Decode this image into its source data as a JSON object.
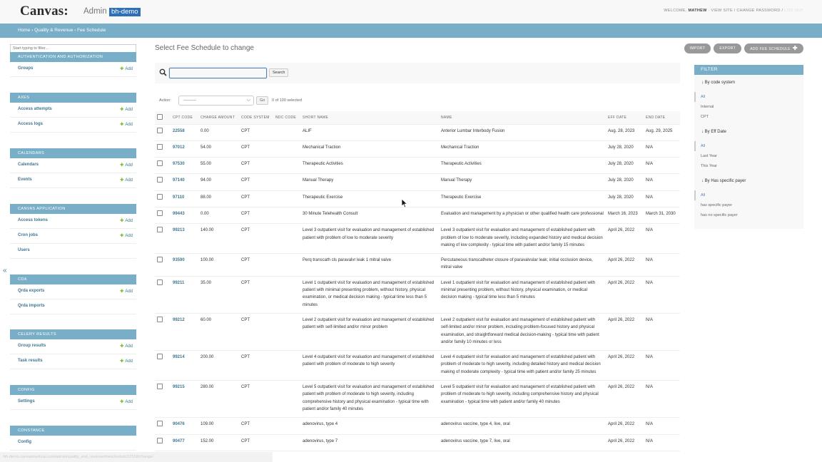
{
  "header": {
    "brand": "Canvas:",
    "admin": "Admin",
    "site": "bh-demo",
    "welcome": "WELCOME,",
    "user": "MATHEW",
    "view_site": "VIEW SITE",
    "change_password": "CHANGE PASSWORD",
    "logout": "LOG OUT"
  },
  "breadcrumbs": "Home › Quality & Revenue › Fee Schedule",
  "sidebar": {
    "filter_placeholder": "Start typing to filter...",
    "add_label": "Add",
    "collapse": "«",
    "modules": [
      {
        "caption": "AUTHENTICATION AND AUTHORIZATION",
        "rows": [
          {
            "name": "Groups",
            "add": true
          }
        ]
      },
      {
        "caption": "AXES",
        "rows": [
          {
            "name": "Access attempts",
            "add": true
          },
          {
            "name": "Access logs",
            "add": true
          }
        ]
      },
      {
        "caption": "CALENDARS",
        "rows": [
          {
            "name": "Calendars",
            "add": true
          },
          {
            "name": "Events",
            "add": true
          }
        ]
      },
      {
        "caption": "CANVAS APPLICATION",
        "rows": [
          {
            "name": "Access tokens",
            "add": true
          },
          {
            "name": "Cron jobs",
            "add": true
          },
          {
            "name": "Users",
            "add": false
          }
        ]
      },
      {
        "caption": "CDA",
        "rows": [
          {
            "name": "Qrda exports",
            "add": true
          },
          {
            "name": "Qrda imports",
            "add": false
          }
        ]
      },
      {
        "caption": "CELERY RESULTS",
        "rows": [
          {
            "name": "Group results",
            "add": true
          },
          {
            "name": "Task results",
            "add": true
          }
        ]
      },
      {
        "caption": "CONFIG",
        "rows": [
          {
            "name": "Settings",
            "add": true
          }
        ]
      },
      {
        "caption": "CONSTANCE",
        "rows": [
          {
            "name": "Config",
            "add": false
          }
        ]
      }
    ]
  },
  "content": {
    "title": "Select Fee Schedule to change",
    "tools": {
      "import": "IMPORT",
      "export": "EXPORT",
      "add": "ADD FEE SCHEDULE",
      "add_icon": "plus-icon"
    },
    "search": {
      "button": "Search",
      "value": "",
      "icon": "search-icon"
    },
    "actions": {
      "label": "Action:",
      "selected": "---------",
      "go": "Go",
      "counter": "0 of 100 selected"
    },
    "columns": [
      "CPT CODE",
      "CHARGE AMOUNT",
      "CODE SYSTEM",
      "NDC CODE",
      "SHORT NAME",
      "NAME",
      "EFF DATE",
      "END DATE"
    ],
    "rows": [
      {
        "cpt": "22558",
        "amount": "0.00",
        "system": "CPT",
        "ndc": "",
        "short": "ALIF",
        "name": "Anterior Lumbar Interbody Fusion",
        "eff": "Aug. 28, 2023",
        "end": "Aug. 29, 2025"
      },
      {
        "cpt": "97012",
        "amount": "54.00",
        "system": "CPT",
        "ndc": "",
        "short": "Mechanical Traction",
        "name": "Mechanical Traction",
        "eff": "July 28, 2020",
        "end": "N/A"
      },
      {
        "cpt": "97530",
        "amount": "55.00",
        "system": "CPT",
        "ndc": "",
        "short": "Therapeutic Activities",
        "name": "Therapeutic Activities",
        "eff": "July 28, 2020",
        "end": "N/A"
      },
      {
        "cpt": "97140",
        "amount": "94.00",
        "system": "CPT",
        "ndc": "",
        "short": "Manual Therapy",
        "name": "Manual Therapy",
        "eff": "July 28, 2020",
        "end": "N/A"
      },
      {
        "cpt": "97110",
        "amount": "88.00",
        "system": "CPT",
        "ndc": "",
        "short": "Therapeutic Exercise",
        "name": "Therapeutic Exercise",
        "eff": "July 28, 2020",
        "end": "N/A"
      },
      {
        "cpt": "99443",
        "amount": "0.00",
        "system": "CPT",
        "ndc": "",
        "short": "30 Minute Telehealth Consult",
        "name": "Evaluation and management by a physician or other qualified health care professional",
        "eff": "March 16, 2023",
        "end": "March 31, 2030"
      },
      {
        "cpt": "99213",
        "amount": "140.00",
        "system": "CPT",
        "ndc": "",
        "short": "Level 3 outpatient visit for evaluation and management of established patient with problem of low to moderate severity",
        "name": "Level 3 outpatient visit for evaluation and management of established patient with problem of low to moderate severity, including expanded history and medical decision making of low complexity - typical time with patient and/or family 15 minutes",
        "eff": "April 26, 2022",
        "end": "N/A"
      },
      {
        "cpt": "93590",
        "amount": "100.00",
        "system": "CPT",
        "ndc": "",
        "short": "Perq transcath cls paravalvr leak 1 mitral valve",
        "name": "Percutaneous transcatheter closure of paravalvular leak; initial occlusion device, mitral valve",
        "eff": "April 26, 2022",
        "end": "N/A"
      },
      {
        "cpt": "99211",
        "amount": "35.00",
        "system": "CPT",
        "ndc": "",
        "short": "Level 1 outpatient visit for evaluation and management of established patient with minimal presenting problem, without history, physical examination, or medical decision making - typical time less than 5 minutes",
        "name": "Level 1 outpatient visit for evaluation and management of established patient with minimal presenting problem, without history, physical examination, or medical decision making - typical time less than 5 minutes",
        "eff": "April 26, 2022",
        "end": "N/A"
      },
      {
        "cpt": "99212",
        "amount": "60.00",
        "system": "CPT",
        "ndc": "",
        "short": "Level 2 outpatient visit for evaluation and management of established patient with self-limited and/or minor problem",
        "name": "Level 2 outpatient visit for evaluation and management of established patient with self-limited and/or minor problem, including problem-focused history and physical examination, and straightforward medical decision-making - typical time with patient and/or family 10 minutes or less",
        "eff": "April 26, 2022",
        "end": "N/A"
      },
      {
        "cpt": "99214",
        "amount": "200.00",
        "system": "CPT",
        "ndc": "",
        "short": "Level 4 outpatient visit for evaluation and management of established patient with problem of moderate to high severity",
        "name": "Level 4 outpatient visit for evaluation and management of established patient with problem of moderate to high severity, including detailed history and medical decision making of moderate complexity - typical time with patient and/or family 25 minutes",
        "eff": "April 26, 2022",
        "end": "N/A"
      },
      {
        "cpt": "99215",
        "amount": "280.00",
        "system": "CPT",
        "ndc": "",
        "short": "Level 5 outpatient visit for evaluation and management of established patient with problem of moderate to high severity, including comprehensive history and physical examination - typical time with patient and/or family 40 minutes",
        "name": "Level 5 outpatient visit for evaluation and management of established patient with problem of moderate to high severity, including comprehensive history and physical examination - typical time with patient and/or family 40 minutes",
        "eff": "April 26, 2022",
        "end": "N/A"
      },
      {
        "cpt": "90476",
        "amount": "109.00",
        "system": "CPT",
        "ndc": "",
        "short": "adenovirus, type 4",
        "name": "adenovirus vaccine, type 4, live, oral",
        "eff": "April 26, 2022",
        "end": "N/A"
      },
      {
        "cpt": "90477",
        "amount": "152.00",
        "system": "CPT",
        "ndc": "",
        "short": "adenovirus, type 7",
        "name": "adenovirus vaccine, type 7, live, oral",
        "eff": "April 26, 2022",
        "end": "N/A"
      }
    ]
  },
  "filter": {
    "title": "FILTER",
    "groups": [
      {
        "heading": "↓ By code system",
        "options": [
          "All",
          "Internal",
          "CPT"
        ],
        "selected": 0
      },
      {
        "heading": "↓ By Eff Date",
        "options": [
          "All",
          "Last Year",
          "This Year"
        ],
        "selected": 0
      },
      {
        "heading": "↓ By Has specific payer",
        "options": [
          "All",
          "has specific payer",
          "has no specific payer"
        ],
        "selected": 0
      }
    ]
  },
  "statusbar": "bh-demo.canvasmedical.com/admin/quality_and_revenue/feeschedule/22558/change/"
}
